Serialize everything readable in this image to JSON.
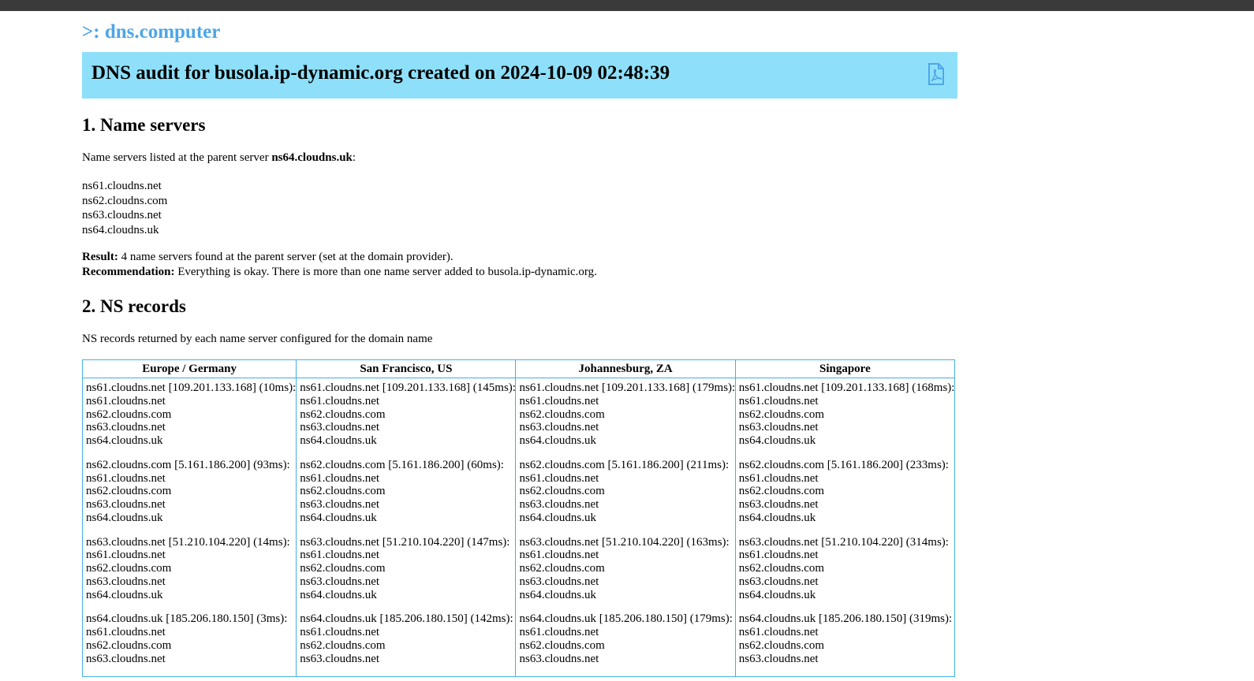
{
  "brand": {
    "logo_text": ">: dns.computer",
    "accent": "#4da6e6"
  },
  "banner": {
    "title": "DNS audit for busola.ip-dynamic.org created on 2024-10-09 02:48:39",
    "background": "#8ee0fa",
    "pdf_icon": "pdf-file-icon"
  },
  "section1": {
    "heading": "1. Name servers",
    "intro_prefix": "Name servers listed at the parent server ",
    "parent_server": "ns64.cloudns.uk",
    "intro_suffix": ":",
    "name_servers": [
      "ns61.cloudns.net",
      "ns62.cloudns.com",
      "ns63.cloudns.net",
      "ns64.cloudns.uk"
    ],
    "result_label": "Result:",
    "result_text": " 4 name servers found at the parent server (set at the domain provider).",
    "recommendation_label": "Recommendation:",
    "recommendation_text": " Everything is okay. There is more than one name server added to busola.ip-dynamic.org."
  },
  "section2": {
    "heading": "2. NS records",
    "intro": "NS records returned by each name server configured for the domain name",
    "table_border_color": "#45aee8",
    "columns": [
      {
        "location": "Europe / Germany",
        "blocks": [
          {
            "header": "ns61.cloudns.net [109.201.133.168] (10ms):",
            "records": [
              "ns61.cloudns.net",
              "ns62.cloudns.com",
              "ns63.cloudns.net",
              "ns64.cloudns.uk"
            ]
          },
          {
            "header": "ns62.cloudns.com [5.161.186.200] (93ms):",
            "records": [
              "ns61.cloudns.net",
              "ns62.cloudns.com",
              "ns63.cloudns.net",
              "ns64.cloudns.uk"
            ]
          },
          {
            "header": "ns63.cloudns.net [51.210.104.220] (14ms):",
            "records": [
              "ns61.cloudns.net",
              "ns62.cloudns.com",
              "ns63.cloudns.net",
              "ns64.cloudns.uk"
            ]
          },
          {
            "header": "ns64.cloudns.uk [185.206.180.150] (3ms):",
            "records": [
              "ns61.cloudns.net",
              "ns62.cloudns.com",
              "ns63.cloudns.net"
            ]
          }
        ]
      },
      {
        "location": "San Francisco, US",
        "blocks": [
          {
            "header": "ns61.cloudns.net [109.201.133.168] (145ms):",
            "records": [
              "ns61.cloudns.net",
              "ns62.cloudns.com",
              "ns63.cloudns.net",
              "ns64.cloudns.uk"
            ]
          },
          {
            "header": "ns62.cloudns.com [5.161.186.200] (60ms):",
            "records": [
              "ns61.cloudns.net",
              "ns62.cloudns.com",
              "ns63.cloudns.net",
              "ns64.cloudns.uk"
            ]
          },
          {
            "header": "ns63.cloudns.net [51.210.104.220] (147ms):",
            "records": [
              "ns61.cloudns.net",
              "ns62.cloudns.com",
              "ns63.cloudns.net",
              "ns64.cloudns.uk"
            ]
          },
          {
            "header": "ns64.cloudns.uk [185.206.180.150] (142ms):",
            "records": [
              "ns61.cloudns.net",
              "ns62.cloudns.com",
              "ns63.cloudns.net"
            ]
          }
        ]
      },
      {
        "location": "Johannesburg, ZA",
        "blocks": [
          {
            "header": "ns61.cloudns.net [109.201.133.168] (179ms):",
            "records": [
              "ns61.cloudns.net",
              "ns62.cloudns.com",
              "ns63.cloudns.net",
              "ns64.cloudns.uk"
            ]
          },
          {
            "header": "ns62.cloudns.com [5.161.186.200] (211ms):",
            "records": [
              "ns61.cloudns.net",
              "ns62.cloudns.com",
              "ns63.cloudns.net",
              "ns64.cloudns.uk"
            ]
          },
          {
            "header": "ns63.cloudns.net [51.210.104.220] (163ms):",
            "records": [
              "ns61.cloudns.net",
              "ns62.cloudns.com",
              "ns63.cloudns.net",
              "ns64.cloudns.uk"
            ]
          },
          {
            "header": "ns64.cloudns.uk [185.206.180.150] (179ms):",
            "records": [
              "ns61.cloudns.net",
              "ns62.cloudns.com",
              "ns63.cloudns.net"
            ]
          }
        ]
      },
      {
        "location": "Singapore",
        "blocks": [
          {
            "header": "ns61.cloudns.net [109.201.133.168] (168ms):",
            "records": [
              "ns61.cloudns.net",
              "ns62.cloudns.com",
              "ns63.cloudns.net",
              "ns64.cloudns.uk"
            ]
          },
          {
            "header": "ns62.cloudns.com [5.161.186.200] (233ms):",
            "records": [
              "ns61.cloudns.net",
              "ns62.cloudns.com",
              "ns63.cloudns.net",
              "ns64.cloudns.uk"
            ]
          },
          {
            "header": "ns63.cloudns.net [51.210.104.220] (314ms):",
            "records": [
              "ns61.cloudns.net",
              "ns62.cloudns.com",
              "ns63.cloudns.net",
              "ns64.cloudns.uk"
            ]
          },
          {
            "header": "ns64.cloudns.uk [185.206.180.150] (319ms):",
            "records": [
              "ns61.cloudns.net",
              "ns62.cloudns.com",
              "ns63.cloudns.net"
            ]
          }
        ]
      }
    ]
  }
}
